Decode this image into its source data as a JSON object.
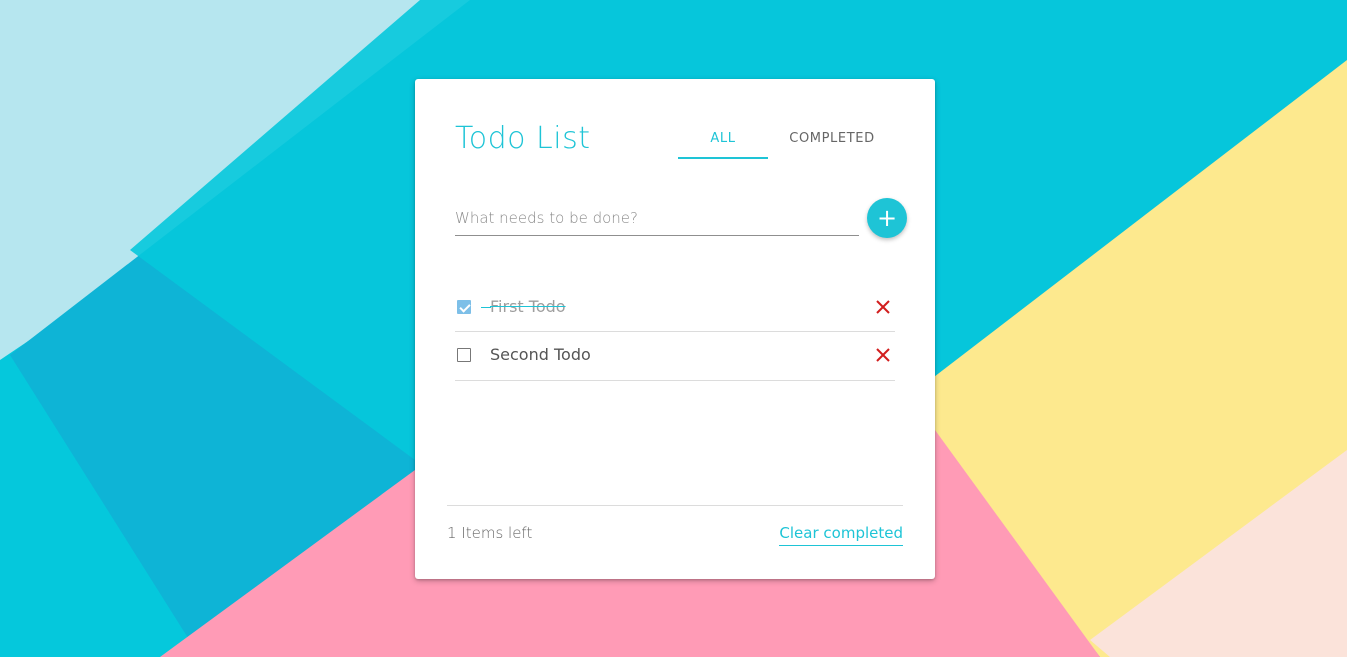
{
  "colors": {
    "accent": "#1ec4d6",
    "delete": "#d21e1e",
    "checked": "#7dbfe8",
    "bg_light_blue": "#b6e6ef",
    "bg_cyan": "#05c8dc",
    "bg_teal": "#0eb4d6",
    "bg_pink": "#ff9bb6",
    "bg_yellow": "#fde98e",
    "bg_peach": "#fbe3da"
  },
  "header": {
    "title": "Todo List"
  },
  "tabs": [
    {
      "label": "ALL",
      "active": true
    },
    {
      "label": "COMPLETED",
      "active": false
    }
  ],
  "new_todo": {
    "placeholder": "What needs to be done?",
    "value": "",
    "add_icon": "plus-icon",
    "add_label": "+"
  },
  "todos": [
    {
      "text": "First Todo",
      "completed": true
    },
    {
      "text": "Second Todo",
      "completed": false
    }
  ],
  "footer": {
    "items_left": "1 Items left",
    "clear_completed": "Clear completed"
  }
}
